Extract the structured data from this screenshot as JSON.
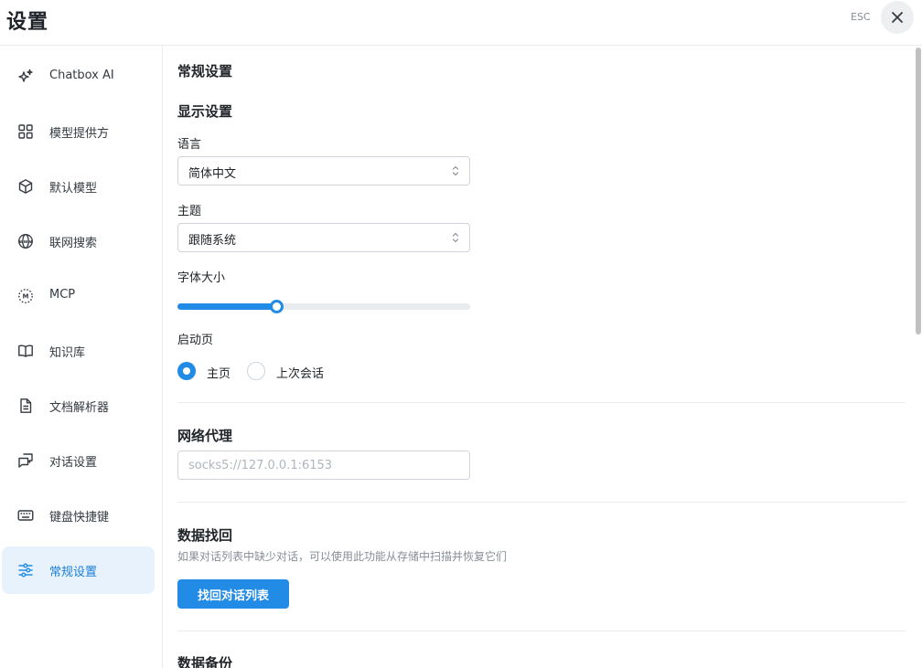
{
  "header": {
    "title": "设置",
    "esc_label": "ESC"
  },
  "sidebar": {
    "items": [
      {
        "label": "Chatbox AI",
        "icon": "sparkles-icon"
      },
      {
        "label": "模型提供方",
        "icon": "grid-icon"
      },
      {
        "label": "默认模型",
        "icon": "cube-icon"
      },
      {
        "label": "联网搜索",
        "icon": "www-globe-icon"
      },
      {
        "label": "MCP",
        "icon": "mcp-icon"
      },
      {
        "label": "知识库",
        "icon": "book-icon"
      },
      {
        "label": "文档解析器",
        "icon": "document-icon"
      },
      {
        "label": "对话设置",
        "icon": "chat-icon"
      },
      {
        "label": "键盘快捷键",
        "icon": "keyboard-icon"
      },
      {
        "label": "常规设置",
        "icon": "sliders-icon",
        "active": true
      }
    ]
  },
  "main": {
    "page_title": "常规设置",
    "display": {
      "title": "显示设置",
      "language_label": "语言",
      "language_value": "简体中文",
      "theme_label": "主题",
      "theme_value": "跟随系统",
      "font_size_label": "字体大小",
      "font_size_level": 0.34,
      "startup_label": "启动页",
      "startup_options": [
        {
          "label": "主页",
          "checked": true
        },
        {
          "label": "上次会话",
          "checked": false
        }
      ]
    },
    "proxy": {
      "title": "网络代理",
      "placeholder": "socks5://127.0.0.1:6153"
    },
    "recovery": {
      "title": "数据找回",
      "description": "如果对话列表中缺少对话，可以使用此功能从存储中扫描并恢复它们",
      "button_label": "找回对话列表"
    },
    "backup": {
      "title": "数据备份"
    }
  },
  "colors": {
    "accent": "#228be6",
    "active_bg": "#e7f2fd",
    "border": "#ced4da"
  }
}
